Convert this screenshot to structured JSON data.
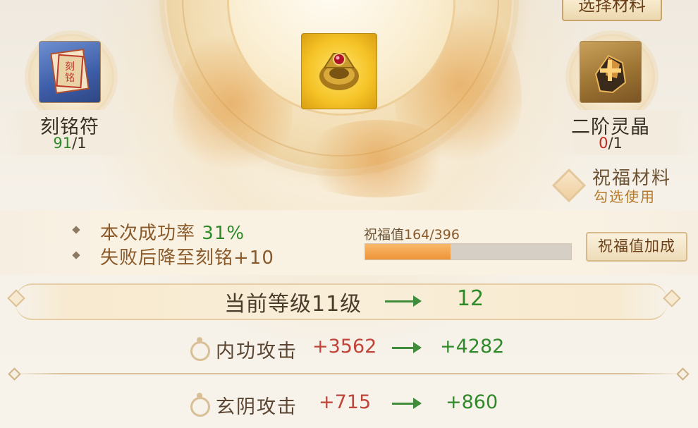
{
  "top_button": {
    "label": "选择材料"
  },
  "materials": {
    "left": {
      "name": "刻铭符",
      "owned": "91",
      "required": "/1",
      "icon": "talisman-icon"
    },
    "right": {
      "name": "二阶灵晶",
      "owned": "0",
      "required": "/1",
      "icon": "spirit-crystal-icon"
    }
  },
  "equipment": {
    "icon": "gold-ring-gem-icon"
  },
  "blessing_material": {
    "title": "祝福材料",
    "subtitle": "勾选使用"
  },
  "info": {
    "success_prefix": "本次成功率",
    "success_rate": "31%",
    "fail_text": "失败后降至刻铭+10"
  },
  "blessing": {
    "label": "祝福值",
    "value_text": "164/396",
    "current": 164,
    "max": 396,
    "bonus_button": "祝福值加成"
  },
  "level": {
    "label": "当前等级11级",
    "next": "12"
  },
  "stats": [
    {
      "name": "内功攻击",
      "old": "+3562",
      "new": "+4282"
    },
    {
      "name": "玄阴攻击",
      "old": "+715",
      "new": "+860"
    }
  ],
  "colors": {
    "success": "#2f8a2a",
    "warning": "#c5261f",
    "progress": "#ee9438",
    "accent": "#8a5a2a"
  }
}
